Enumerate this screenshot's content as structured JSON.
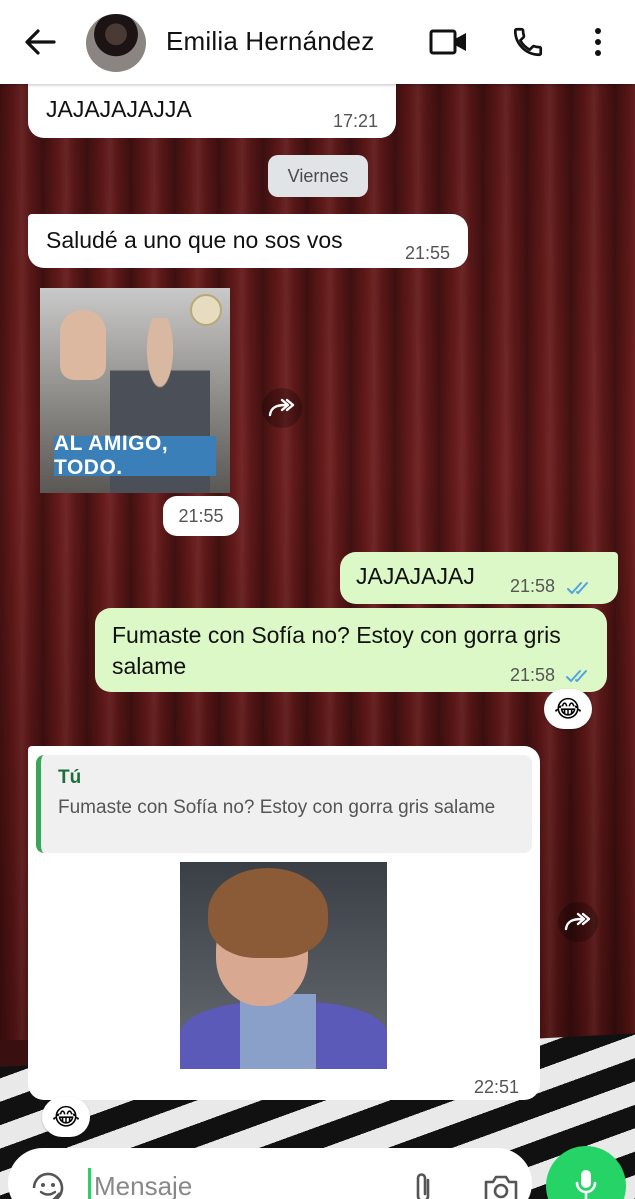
{
  "header": {
    "contact_name": "Emilia Hernández",
    "icons": {
      "back": "arrow-left-icon",
      "video": "video-camera-icon",
      "call": "phone-icon",
      "menu": "more-vertical-icon"
    }
  },
  "colors": {
    "incoming_bubble": "#ffffff",
    "outgoing_bubble": "#dcf8c6",
    "read_ticks": "#4fa3e0",
    "accent": "#25d366",
    "quote_bar": "#3aa65a"
  },
  "messages": [
    {
      "direction": "in",
      "text": "JAJAJAJAJJA",
      "time": "17:21"
    },
    {
      "type": "date_separator",
      "text": "Viernes"
    },
    {
      "direction": "in",
      "text": "Saludé a uno que no sos vos",
      "time": "21:55"
    },
    {
      "direction": "in",
      "type": "sticker",
      "caption": "AL AMIGO, TODO.",
      "time": "21:55"
    },
    {
      "direction": "out",
      "text": "JAJAJAJAJ",
      "time": "21:58",
      "status": "read"
    },
    {
      "direction": "out",
      "text": "Fumaste con Sofía no? Estoy con gorra gris salame",
      "time": "21:58",
      "status": "read",
      "reaction": "😂"
    },
    {
      "direction": "in",
      "type": "image_reply",
      "quote": {
        "author": "Tú",
        "text": "Fumaste con Sofía no? Estoy con gorra gris salame"
      },
      "time": "22:51",
      "reaction": "😂"
    }
  ],
  "composer": {
    "placeholder": "Mensaje"
  }
}
